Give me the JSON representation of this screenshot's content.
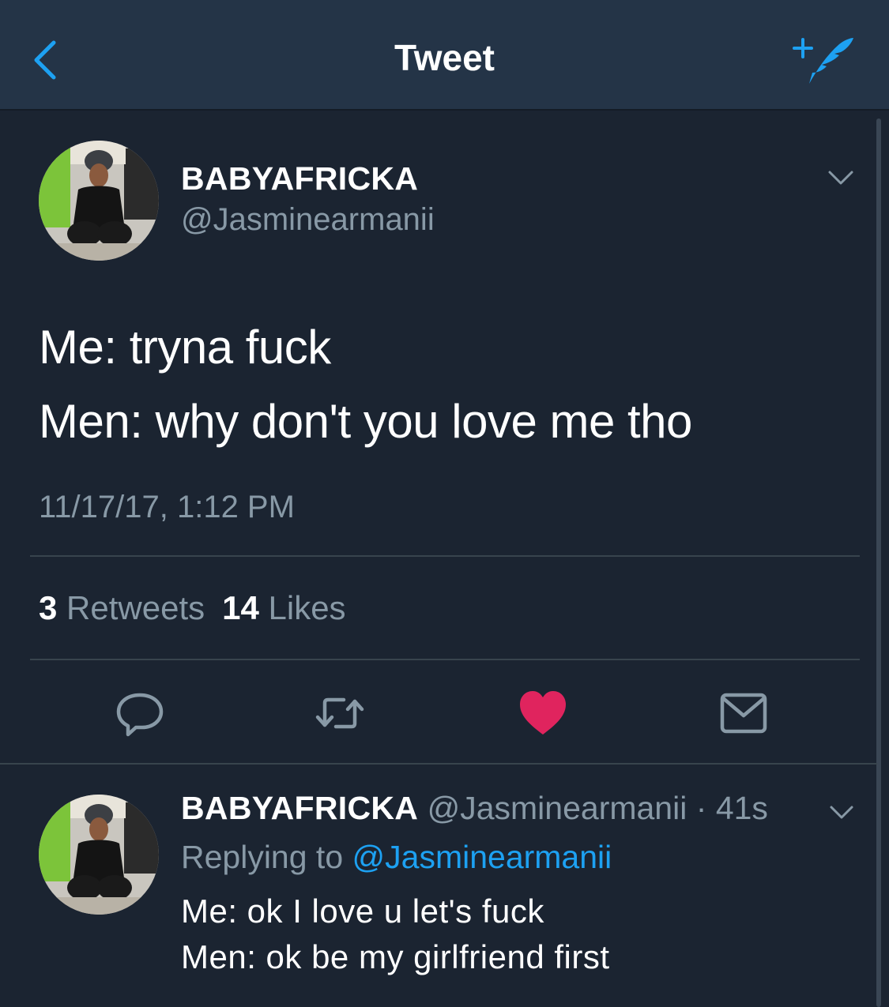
{
  "navbar": {
    "title": "Tweet",
    "back_icon": "chevron-left-icon",
    "compose_icon": "compose-tweet-icon",
    "accent_color": "#1da1f2"
  },
  "main_tweet": {
    "display_name": "BABYAFRICKA",
    "handle": "@Jasminearmanii",
    "text_lines": [
      "Me: tryna fuck",
      "Men: why don't you love me tho"
    ],
    "timestamp": "11/17/17, 1:12 PM",
    "retweet_count": "3",
    "retweet_label": "Retweets",
    "like_count": "14",
    "like_label": "Likes",
    "liked": true,
    "like_color": "#e0245e",
    "actions": [
      "reply-icon",
      "retweet-icon",
      "heart-icon",
      "direct-message-icon"
    ]
  },
  "reply_tweet": {
    "display_name": "BABYAFRICKA",
    "handle": "@Jasminearmanii",
    "time_ago": "41s",
    "separator": "·",
    "replying_to_label": "Replying to",
    "replying_to_handle": "@Jasminearmanii",
    "text_lines": [
      "Me: ok I love u let's fuck",
      "Men: ok be my girlfriend first"
    ]
  }
}
